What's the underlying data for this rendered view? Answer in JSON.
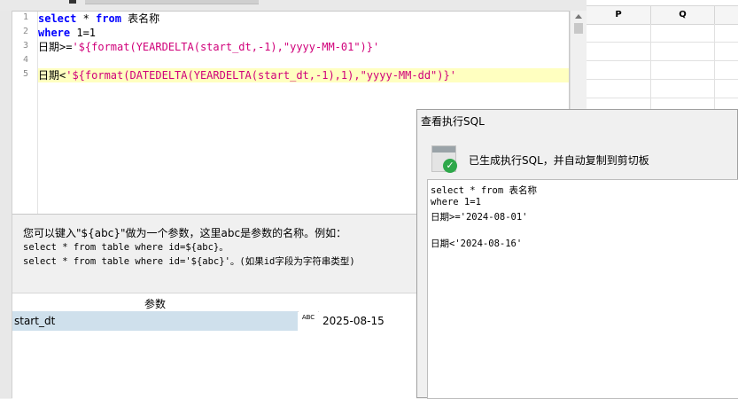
{
  "editor": {
    "line_numbers": [
      "1",
      "2",
      "3",
      "4",
      "5"
    ],
    "line1": {
      "kw1": "select",
      "mid": " * ",
      "kw2": "from",
      "rest": " 表名称"
    },
    "line2": {
      "kw": "where",
      "rest": " 1=1"
    },
    "line3": {
      "prefix": "日期>=",
      "expr": "'${format(YEARDELTA(start_dt,-1),\"yyyy-MM-01\")}'"
    },
    "line5": {
      "prefix": "日期<",
      "expr": "'${format(DATEDELTA(YEARDELTA(start_dt,-1),1),\"yyyy-MM-dd\")}'"
    }
  },
  "hint": {
    "line1": "您可以键入\"${abc}\"做为一个参数，这里abc是参数的名称。例如：",
    "line2": "select * from table where id=${abc}。",
    "line3": "select * from table where id='${abc}'。(如果id字段为字符串类型)"
  },
  "params": {
    "header": "参数",
    "rows": [
      {
        "name": "start_dt",
        "type_icon": "ABC",
        "value": "2025-08-15"
      }
    ]
  },
  "sheet": {
    "columns": [
      "P",
      "Q"
    ]
  },
  "dialog": {
    "title": "查看执行SQL",
    "message": "已生成执行SQL，并自动复制到剪切板",
    "sql_lines": [
      "select * from 表名称",
      "where 1=1",
      "日期>='2024-08-01'",
      "",
      "日期<'2024-08-16'"
    ]
  }
}
